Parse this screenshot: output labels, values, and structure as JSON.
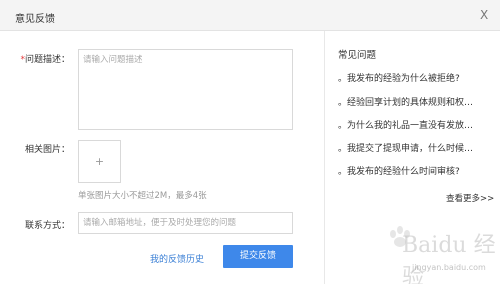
{
  "dialog": {
    "title": "意见反馈",
    "close_label": "X"
  },
  "form": {
    "required_mark": "*",
    "description_label": "问题描述：",
    "description_placeholder": "请输入问题描述",
    "images_label": "相关图片：",
    "upload_glyph": "+",
    "images_hint": "单张图片大小不超过2M，最多4张",
    "contact_label": "联系方式：",
    "contact_placeholder": "请输入邮箱地址，便于及时处理您的问题",
    "history_link": "我的反馈历史",
    "submit_button": "提交反馈"
  },
  "faq": {
    "title": "常见问题",
    "items": [
      "。我发布的经验为什么被拒绝?",
      "。经验回享计划的具体规则和权…",
      "。为什么我的礼品一直没有发放…",
      "。我提交了提现申请，什么时候…",
      "。我发布的经验什么时间审核?"
    ],
    "more_link": "查看更多>>"
  },
  "watermark": {
    "text": "Baidu 经验",
    "url": "jingyan.baidu.com"
  },
  "colors": {
    "accent": "#3e88ea",
    "link": "#3a7fd5",
    "required": "#e4393c"
  }
}
